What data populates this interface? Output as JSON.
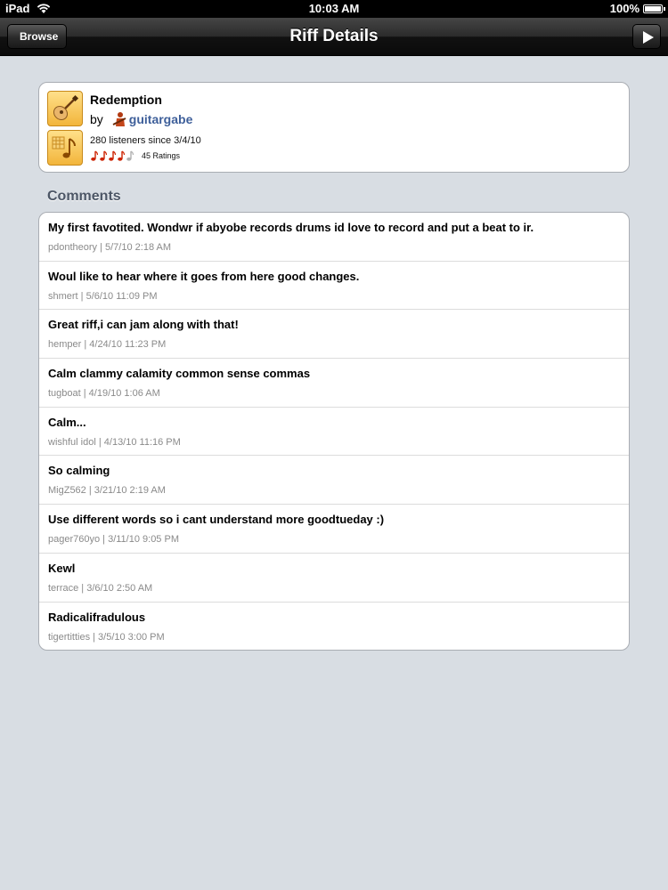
{
  "status_bar": {
    "device": "iPad",
    "time": "10:03 AM",
    "battery": "100%"
  },
  "nav_bar": {
    "back_label": "Browse",
    "title": "Riff Details"
  },
  "riff": {
    "title": "Redemption",
    "by_label": "by",
    "author": "guitargabe",
    "listeners": "280 listeners since 3/4/10",
    "rating_value": 4,
    "rating_max": 5,
    "ratings_count": "45 Ratings",
    "accent_color": "#cc2200"
  },
  "comments_header": "Comments",
  "comments": [
    {
      "text": "My first favotited. Wondwr if abyobe records drums id love to record and put a beat to ir.",
      "meta": "pdontheory | 5/7/10 2:18 AM"
    },
    {
      "text": "Woul like to hear where it goes from here good changes.",
      "meta": "shmert | 5/6/10 11:09 PM"
    },
    {
      "text": "Great riff,i can jam along with that!",
      "meta": "hemper | 4/24/10 11:23 PM"
    },
    {
      "text": "Calm clammy calamity common sense commas",
      "meta": "tugboat | 4/19/10 1:06 AM"
    },
    {
      "text": "Calm...",
      "meta": "wishful idol | 4/13/10 11:16 PM"
    },
    {
      "text": "So calming",
      "meta": "MigZ562 | 3/21/10 2:19 AM"
    },
    {
      "text": "Use different words so i cant understand more goodtueday :)",
      "meta": "pager760yo | 3/11/10 9:05 PM"
    },
    {
      "text": "Kewl",
      "meta": "terrace | 3/6/10 2:50 AM"
    },
    {
      "text": "Radicalifradulous",
      "meta": "tigertitties | 3/5/10 3:00 PM"
    }
  ]
}
